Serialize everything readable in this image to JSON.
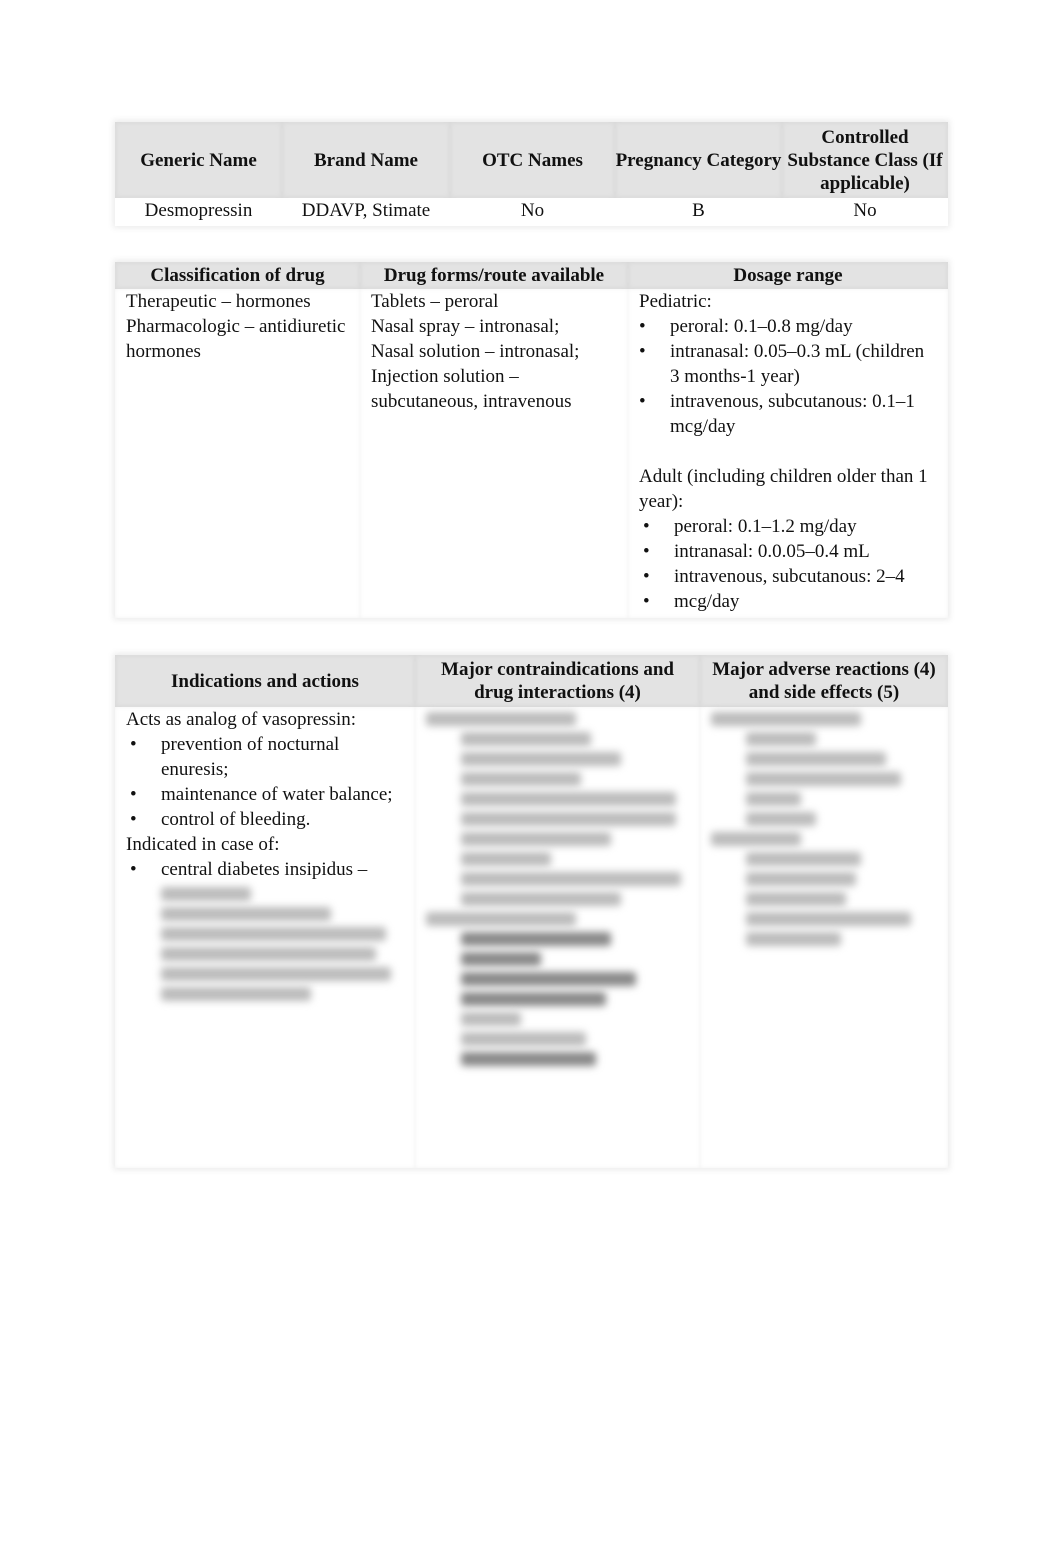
{
  "table1": {
    "headers": [
      "Generic Name",
      "Brand Name",
      "OTC Names",
      "Pregnancy Category",
      "Controlled Substance Class (If applicable)"
    ],
    "row": [
      "Desmopressin",
      "DDAVP, Stimate",
      "No",
      "B",
      "No"
    ]
  },
  "table2": {
    "headers": [
      "Classification of drug",
      "Drug forms/route available",
      "Dosage range"
    ],
    "classification": [
      "Therapeutic – hormones",
      "Pharmacologic – antidiuretic hormones"
    ],
    "forms": [
      "Tablets – peroral",
      "Nasal spray – intronasal;",
      "Nasal solution – intronasal;",
      "Injection solution – subcutaneous, intravenous"
    ],
    "dosage": {
      "pediatric_label": "Pediatric:",
      "pediatric": [
        "peroral: 0.1–0.8 mg/day",
        "intranasal: 0.05–0.3 mL (children 3 months-1 year)",
        "intravenous, subcutanous: 0.1–1 mcg/day"
      ],
      "adult_label": "Adult (including children older than 1 year):",
      "adult": [
        "peroral: 0.1–1.2 mg/day",
        "intranasal: 0.0.05–0.4 mL",
        "intravenous, subcutanous: 2–4",
        "mcg/day"
      ]
    }
  },
  "table3": {
    "headers": [
      "Indications and actions",
      "Major contraindications and drug interactions (4)",
      "Major adverse reactions (4) and side effects (5)"
    ],
    "actions_label": "Acts as analog of vasopressin:",
    "actions": [
      "prevention of nocturnal enuresis;",
      "maintenance of water balance;",
      "control of bleeding."
    ],
    "indicated_label": "Indicated in case of:",
    "indicated": [
      "central diabetes insipidus –"
    ]
  }
}
